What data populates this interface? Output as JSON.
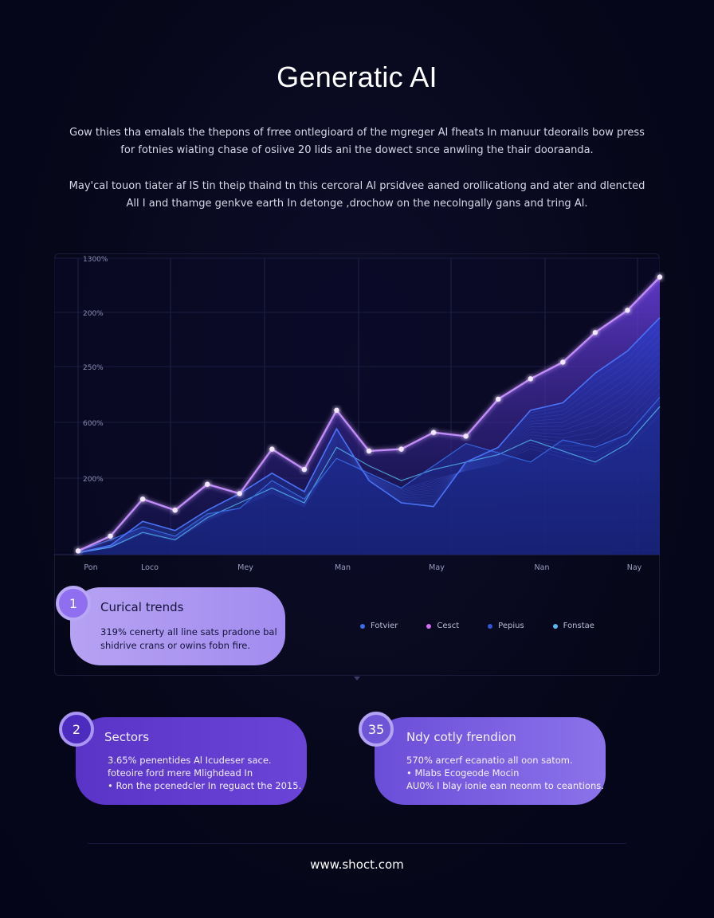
{
  "title": "Generatic AI",
  "paragraphs": [
    "Gow thies tha emalals the thepons of frree ontlegioard of the mgreger AI fheats In manuur tdeorails bow press for fotnies wiating chase of osiive 20 Iids ani the dowect snce anwling the thair dooraanda.",
    "May'cal touon tiater af IS tin theip thaind tn this cercoral AI prsidvee aaned orollicationg and ater and dlencted All I and thamge genkve earth In detonge ,drochow on the necolngally gans and tring Al."
  ],
  "chart_data": {
    "type": "area",
    "y_tick_labels": [
      "1300%",
      "200%",
      "250%",
      "600%",
      "200%"
    ],
    "x_tick_labels": [
      "Pon",
      "Loco",
      "Mey",
      "Man",
      "May",
      "Nan",
      "Nay"
    ],
    "x": [
      0,
      1,
      2,
      3,
      4,
      5,
      6,
      7,
      8,
      9,
      10,
      11,
      12,
      13,
      14,
      15,
      16,
      17,
      18
    ],
    "series": [
      {
        "name": "Fotvier",
        "color": "#3a6ee8",
        "values": [
          2,
          8,
          15,
          10,
          22,
          25,
          40,
          30,
          52,
          44,
          36,
          48,
          60,
          55,
          50,
          62,
          58,
          65,
          85
        ]
      },
      {
        "name": "Cesct",
        "color": "#b469f2",
        "values": [
          2,
          10,
          30,
          24,
          38,
          33,
          57,
          46,
          78,
          56,
          57,
          66,
          64,
          84,
          95,
          104,
          120,
          132,
          150
        ]
      },
      {
        "name": "Pepius",
        "color": "#3555d8",
        "values": [
          1,
          5,
          18,
          13,
          24,
          33,
          44,
          34,
          68,
          40,
          28,
          26,
          50,
          58,
          78,
          82,
          98,
          110,
          128
        ]
      },
      {
        "name": "Fonstae",
        "color": "#58b9f0",
        "values": [
          1,
          4,
          12,
          8,
          20,
          28,
          36,
          28,
          58,
          48,
          40,
          46,
          50,
          54,
          62,
          56,
          50,
          60,
          80
        ]
      }
    ],
    "ylim": [
      0,
      155
    ],
    "grid": true,
    "legend_position": "bottom-right"
  },
  "legend": [
    "Fotvier",
    "Cesct",
    "Pepius",
    "Fonstae"
  ],
  "cards": [
    {
      "badge": "1",
      "title": "Curical trends",
      "text": [
        "319% cenerty all line sats pradone bal",
        "shidrive crans or owins fobn fire."
      ]
    },
    {
      "badge": "2",
      "title": "Sectors",
      "text": [
        "3.65% penentides Al Icudeser sace.",
        "foteoire ford mere Mlighdead In",
        "• Ron the pcenedcler In reguact the 2015."
      ]
    },
    {
      "badge": "35",
      "title": "Ndy cotly frendion",
      "text": [
        "570% arcerf ecanatio all oon satom.",
        "• Mlabs Ecogeode Mocin",
        "AU0% I blay ionie ean neonm to ceantions."
      ]
    }
  ],
  "footer": "www.shoct.com",
  "colors": {
    "accent": "#b469f2",
    "background": "#07071a",
    "card1": "#b6a2f2",
    "card2": "#5a34c6",
    "card3": "#7a60e0"
  }
}
